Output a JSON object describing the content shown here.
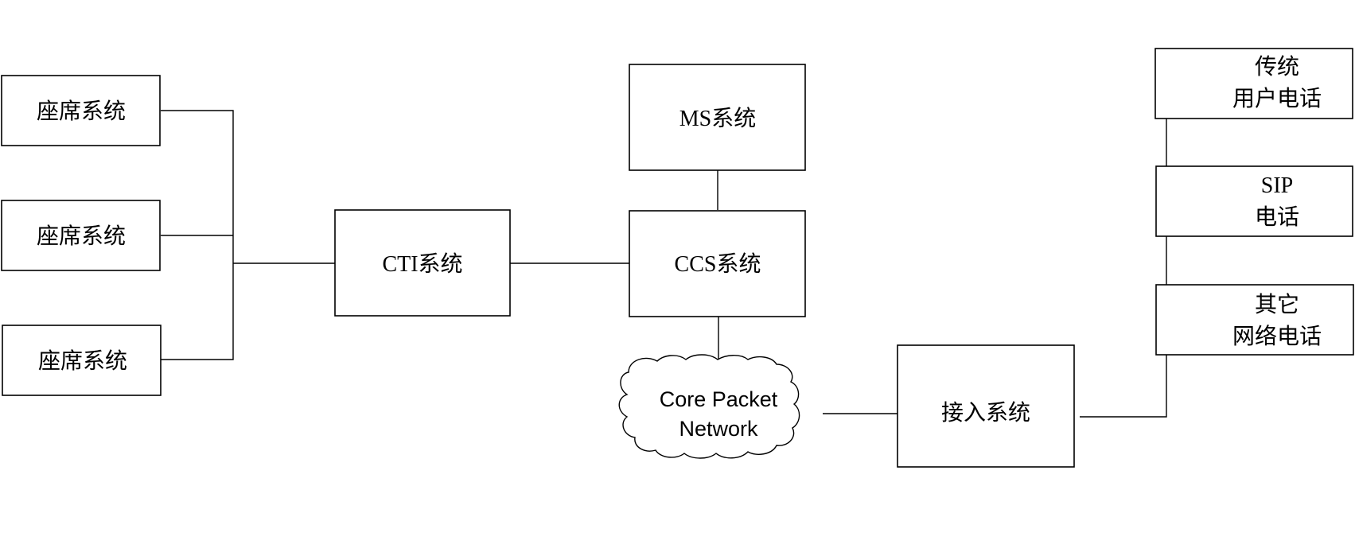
{
  "diagram": {
    "nodes": {
      "agent_1": {
        "label": "座席系统"
      },
      "agent_2": {
        "label": "座席系统"
      },
      "agent_3": {
        "label": "座席系统"
      },
      "cti": {
        "label": "CTI系统"
      },
      "ms": {
        "label": "MS系统"
      },
      "ccs": {
        "label": "CCS系统"
      },
      "core_network": {
        "line1": "Core Packet",
        "line2": "Network"
      },
      "access": {
        "label": "接入系统"
      },
      "phone_traditional": {
        "line1": "传统",
        "line2": "用户电话"
      },
      "phone_sip": {
        "line1": "SIP",
        "line2": "电话"
      },
      "phone_other": {
        "line1": "其它",
        "line2": "网络电话"
      }
    },
    "edges": [
      {
        "from": "agent_1",
        "to": "cti"
      },
      {
        "from": "agent_2",
        "to": "cti"
      },
      {
        "from": "agent_3",
        "to": "cti"
      },
      {
        "from": "cti",
        "to": "ccs"
      },
      {
        "from": "ms",
        "to": "ccs"
      },
      {
        "from": "ccs",
        "to": "core_network"
      },
      {
        "from": "core_network",
        "to": "access"
      },
      {
        "from": "access",
        "to": "phone_traditional"
      },
      {
        "from": "access",
        "to": "phone_sip"
      },
      {
        "from": "access",
        "to": "phone_other"
      }
    ]
  }
}
